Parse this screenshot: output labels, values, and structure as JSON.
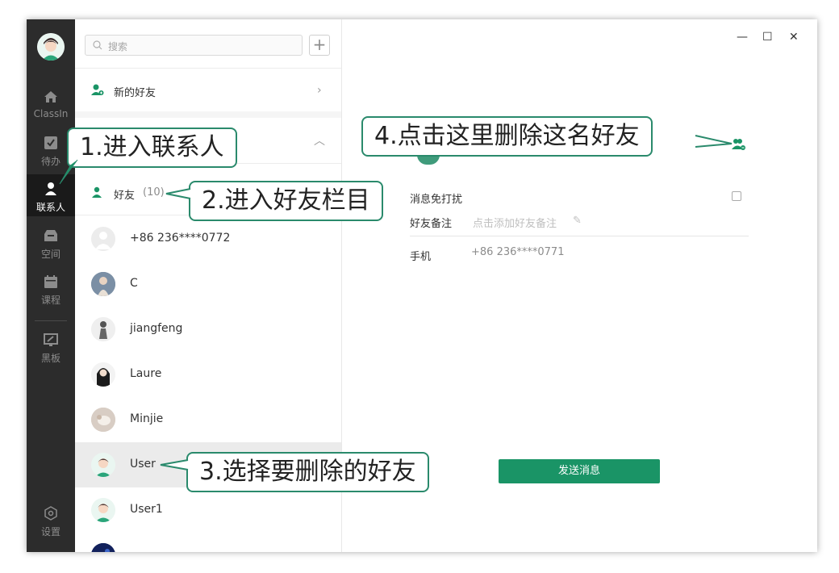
{
  "nav": {
    "items": [
      {
        "label": "ClassIn",
        "icon": "home-icon"
      },
      {
        "label": "待办",
        "icon": "todo-icon"
      },
      {
        "label": "联系人",
        "icon": "contacts-icon"
      },
      {
        "label": "空间",
        "icon": "space-icon"
      },
      {
        "label": "课程",
        "icon": "calendar-icon"
      },
      {
        "label": "黑板",
        "icon": "blackboard-icon"
      }
    ],
    "settings_label": "设置"
  },
  "contacts": {
    "search_placeholder": "搜索",
    "add_label": "+",
    "new_friends_label": "新的好友",
    "friends_label": "好友",
    "friends_count": "(10)",
    "list": [
      {
        "name": "+86 236****0772"
      },
      {
        "name": "C"
      },
      {
        "name": "jiangfeng"
      },
      {
        "name": "Laure"
      },
      {
        "name": "Minjie"
      },
      {
        "name": "User"
      },
      {
        "name": "User1"
      },
      {
        "name": ""
      }
    ]
  },
  "detail": {
    "mute_label": "消息免打扰",
    "remark_label": "好友备注",
    "remark_hint": "点击添加好友备注",
    "phone_label": "手机",
    "phone_value": "+86 236****0771",
    "send_button": "发送消息"
  },
  "callouts": {
    "step1": "1.进入联系人",
    "step2": "2.进入好友栏目",
    "step3": "3.选择要删除的好友",
    "step4": "4.点击这里删除这名好友"
  },
  "colors": {
    "accent": "#1a9466",
    "callout_border": "#2a8a6c",
    "nav_bg": "#2c2c2c"
  }
}
